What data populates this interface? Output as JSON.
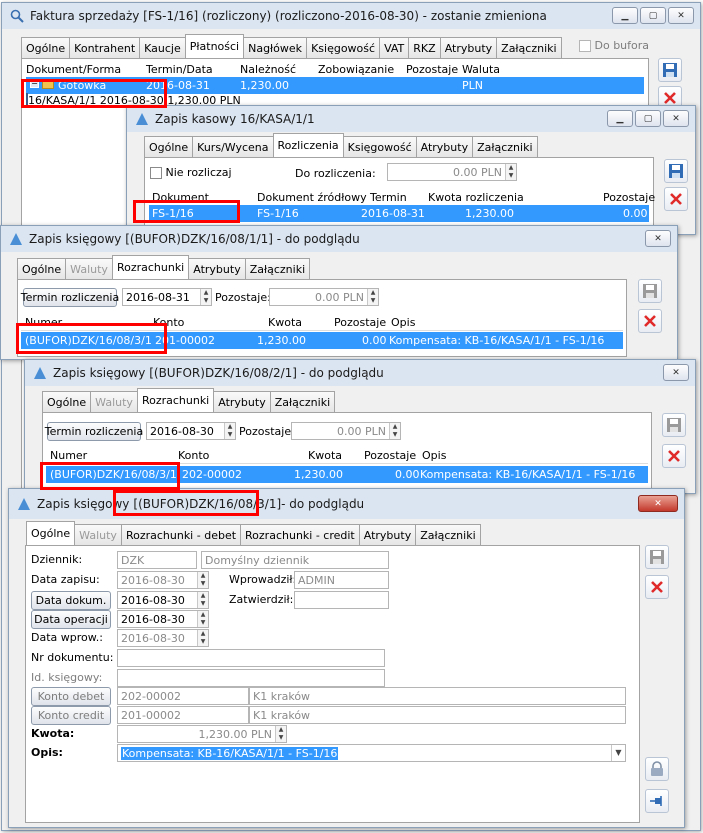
{
  "w1": {
    "title": "Faktura sprzedaży [FS-1/16] (rozliczony) (rozliczono-2016-08-30) - zostanie zmieniona",
    "tabs": [
      "Ogólne",
      "Kontrahent",
      "Kaucje",
      "Płatności",
      "Nagłówek",
      "Księgowość",
      "VAT",
      "RKZ",
      "Atrybuty",
      "Załączniki"
    ],
    "do_bufora": "Do bufora",
    "cols": [
      "Dokument/Forma",
      "Termin/Data",
      "Należność",
      "Zobowiązanie",
      "Pozostaje",
      "Waluta"
    ],
    "rows": [
      [
        "Gotówka",
        "2016-08-31",
        "1,230.00",
        "",
        "",
        "PLN"
      ],
      [
        "16/KASA/1/1",
        "2016-08-30",
        "1,230.00",
        "",
        "",
        "PLN"
      ]
    ]
  },
  "w2": {
    "title": "Zapis kasowy 16/KASA/1/1",
    "tabs": [
      "Ogólne",
      "Kurs/Wycena",
      "Rozliczenia",
      "Księgowość",
      "Atrybuty",
      "Załączniki"
    ],
    "nie_rozliczaj": "Nie rozliczaj",
    "do_rozliczenia_label": "Do rozliczenia:",
    "do_rozliczenia_value": "0.00 PLN",
    "cols": [
      "Dokument",
      "Dokument źródłowy",
      "Termin",
      "Kwota rozliczenia",
      "Pozostaje"
    ],
    "row": [
      "FS-1/16",
      "FS-1/16",
      "2016-08-31",
      "1,230.00",
      "0.00"
    ]
  },
  "w3": {
    "title": "Zapis księgowy [(BUFOR)DZK/16/08/1/1] - do podglądu",
    "tabs": [
      "Ogólne",
      "Waluty",
      "Rozrachunki",
      "Atrybuty",
      "Załączniki"
    ],
    "termin_btn": "Termin rozliczenia",
    "termin": "2016-08-31",
    "pozostaje_label": "Pozostaje:",
    "pozostaje": "0.00 PLN",
    "cols": [
      "Numer",
      "Konto",
      "Kwota",
      "Pozostaje",
      "Opis"
    ],
    "row": [
      "(BUFOR)DZK/16/08/3/1",
      "201-00002",
      "1,230.00",
      "0.00",
      "Kompensata: KB-16/KASA/1/1 - FS-1/16"
    ]
  },
  "w4": {
    "title": "Zapis księgowy [(BUFOR)DZK/16/08/2/1] - do podglądu",
    "tabs": [
      "Ogólne",
      "Waluty",
      "Rozrachunki",
      "Atrybuty",
      "Załączniki"
    ],
    "termin_btn": "Termin rozliczenia",
    "termin": "2016-08-30",
    "pozostaje_label": "Pozostaje:",
    "pozostaje": "0.00 PLN",
    "cols": [
      "Numer",
      "Konto",
      "Kwota",
      "Pozostaje",
      "Opis"
    ],
    "row": [
      "(BUFOR)DZK/16/08/3/1",
      "202-00002",
      "1,230.00",
      "0.00",
      "Kompensata: KB-16/KASA/1/1 - FS-1/16"
    ]
  },
  "w5": {
    "title_a": "Zapis księgowy",
    "title_b": "[(BUFOR)DZK/16/08/3/1]",
    "title_c": " - do podglądu",
    "tabs": [
      "Ogólne",
      "Waluty",
      "Rozrachunki - debet",
      "Rozrachunki - credit",
      "Atrybuty",
      "Załączniki"
    ],
    "dziennik_label": "Dziennik:",
    "dziennik": "DZK",
    "dziennik_name": "Domyślny dziennik",
    "data_zapisu_label": "Data zapisu:",
    "data_zapisu": "2016-08-30",
    "wprowadzil_label": "Wprowadził:",
    "wprowadzil": "ADMIN",
    "zatwierdzil_label": "Zatwierdził:",
    "zatwierdzil": "",
    "data_dokum_btn": "Data dokum.",
    "data_dokum": "2016-08-30",
    "data_operacji_btn": "Data operacji",
    "data_operacji": "2016-08-30",
    "data_wprow_label": "Data wprow.:",
    "data_wprow": "2016-08-30",
    "nr_dok_label": "Nr dokumentu:",
    "id_ksieg_label": "Id. księgowy:",
    "konto_debet_btn": "Konto debet",
    "konto_debet": "202-00002",
    "konto_debet_name": "K1 kraków",
    "konto_credit_btn": "Konto credit",
    "konto_credit": "201-00002",
    "konto_credit_name": "K1 kraków",
    "kwota_label": "Kwota:",
    "kwota": "1,230.00 PLN",
    "opis_label": "Opis:",
    "opis": "Kompensata: KB-16/KASA/1/1 - FS-1/16"
  }
}
